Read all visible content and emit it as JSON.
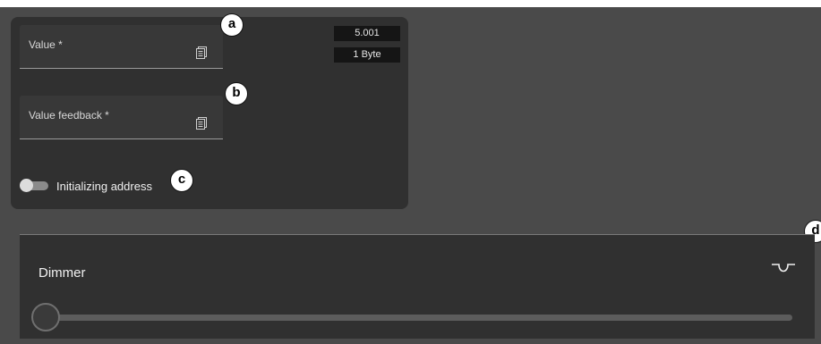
{
  "fields": {
    "value_label": "Value *",
    "value_feedback_label": "Value feedback *"
  },
  "tags": {
    "address": "5.001",
    "size": "1 Byte"
  },
  "toggle": {
    "label": "Initializing address",
    "checked": false
  },
  "callouts": {
    "a": "a",
    "b": "b",
    "c": "c",
    "d": "d"
  },
  "dimmer": {
    "title": "Dimmer",
    "level": 0
  },
  "icons": {
    "field_action": "document-icon",
    "card_action": "curve-switch-icon"
  },
  "colors": {
    "canvas": "#4a4a4a",
    "panel": "#303030",
    "callout_bg": "#ffffff"
  }
}
